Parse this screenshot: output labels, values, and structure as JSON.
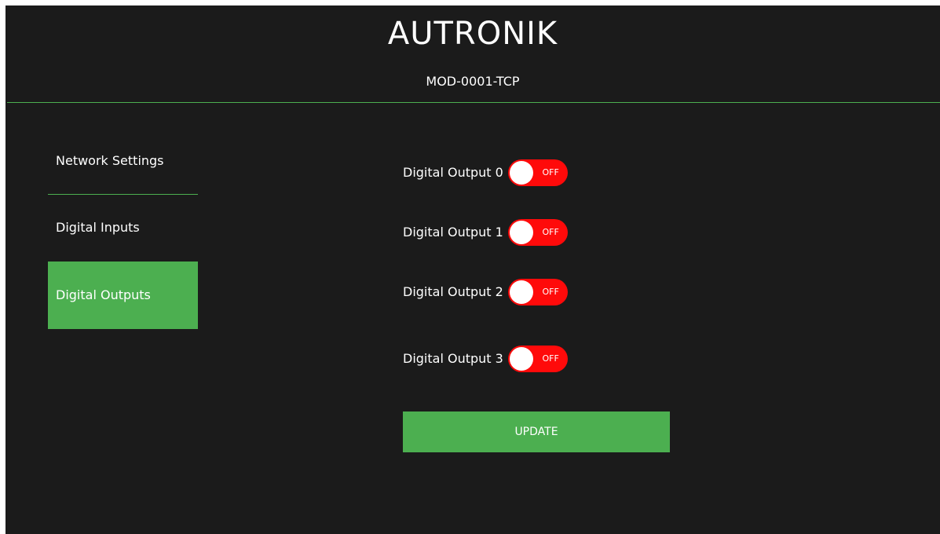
{
  "header": {
    "brand": "AUTRONIK",
    "model": "MOD-0001-TCP"
  },
  "nav": {
    "items": [
      {
        "label": "Network Settings",
        "active": false
      },
      {
        "label": "Digital Inputs",
        "active": false
      },
      {
        "label": "Digital Outputs",
        "active": true
      }
    ]
  },
  "outputs": [
    {
      "label": "Digital Output 0",
      "state": "OFF"
    },
    {
      "label": "Digital Output 1",
      "state": "OFF"
    },
    {
      "label": "Digital Output 2",
      "state": "OFF"
    },
    {
      "label": "Digital Output 3",
      "state": "OFF"
    }
  ],
  "update_button": {
    "label": "UPDATE"
  },
  "colors": {
    "background": "#1b1b1b",
    "accent": "#4caf50",
    "toggle_off": "#ff0a0a",
    "text": "#ffffff"
  }
}
